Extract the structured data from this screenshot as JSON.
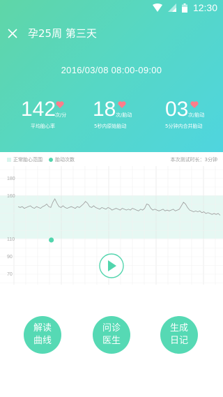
{
  "colors": {
    "accent": "#52d5ad",
    "range_band": "#e6f8f3",
    "header_from": "#5fd6a7",
    "header_to": "#4fd5df"
  },
  "status_bar": {
    "time": "12:30",
    "icons": [
      "wifi-icon",
      "signal-icon",
      "battery-icon"
    ]
  },
  "app_bar": {
    "title": "孕25周 第三天",
    "close_icon": "close-icon"
  },
  "session": {
    "datetime": "2016/03/08  08:00-09:00"
  },
  "stats": [
    {
      "value": "142",
      "unit": "次/分",
      "label": "平均胎心率"
    },
    {
      "value": "18",
      "unit": "次/胎动",
      "label": "5秒内原始胎动"
    },
    {
      "value": "03",
      "unit": "次/胎动",
      "label": "5分钟内合并胎动"
    }
  ],
  "legend": {
    "range_label": "正常胎心范围",
    "movement_label": "胎动次数",
    "duration": "本次测试时长：3分钟"
  },
  "chart_data": {
    "type": "line",
    "y_ticks": [
      "180",
      "160",
      "110",
      "90",
      "70"
    ],
    "normal_range": [
      110,
      160
    ],
    "grid": true,
    "series": [
      {
        "values": [
          147,
          146,
          147,
          145,
          146,
          147,
          148,
          146,
          145,
          147,
          146,
          145,
          147,
          148,
          150,
          147,
          146,
          152,
          156,
          151,
          147,
          146,
          148,
          146,
          145,
          146,
          147,
          146,
          145,
          147,
          146,
          148,
          150,
          153,
          151,
          147,
          146,
          148,
          146,
          145,
          144,
          146,
          145,
          144,
          146,
          145,
          143,
          144,
          145,
          144,
          143,
          145,
          144,
          143,
          144,
          143,
          145,
          144,
          143,
          142,
          144,
          143,
          145,
          150,
          149,
          145,
          143,
          144,
          143,
          142,
          143,
          144,
          142,
          143,
          142,
          143,
          144,
          142,
          143,
          144,
          148,
          152,
          150,
          146,
          143,
          142,
          141,
          142,
          141,
          142,
          140,
          141,
          139,
          140,
          139,
          138,
          139,
          138,
          139,
          137
        ]
      }
    ],
    "movement_markers": [
      0.17
    ]
  },
  "actions": [
    {
      "label_line1": "解读",
      "label_line2": "曲线"
    },
    {
      "label_line1": "问诊",
      "label_line2": "医生"
    },
    {
      "label_line1": "生成",
      "label_line2": "日记"
    }
  ]
}
